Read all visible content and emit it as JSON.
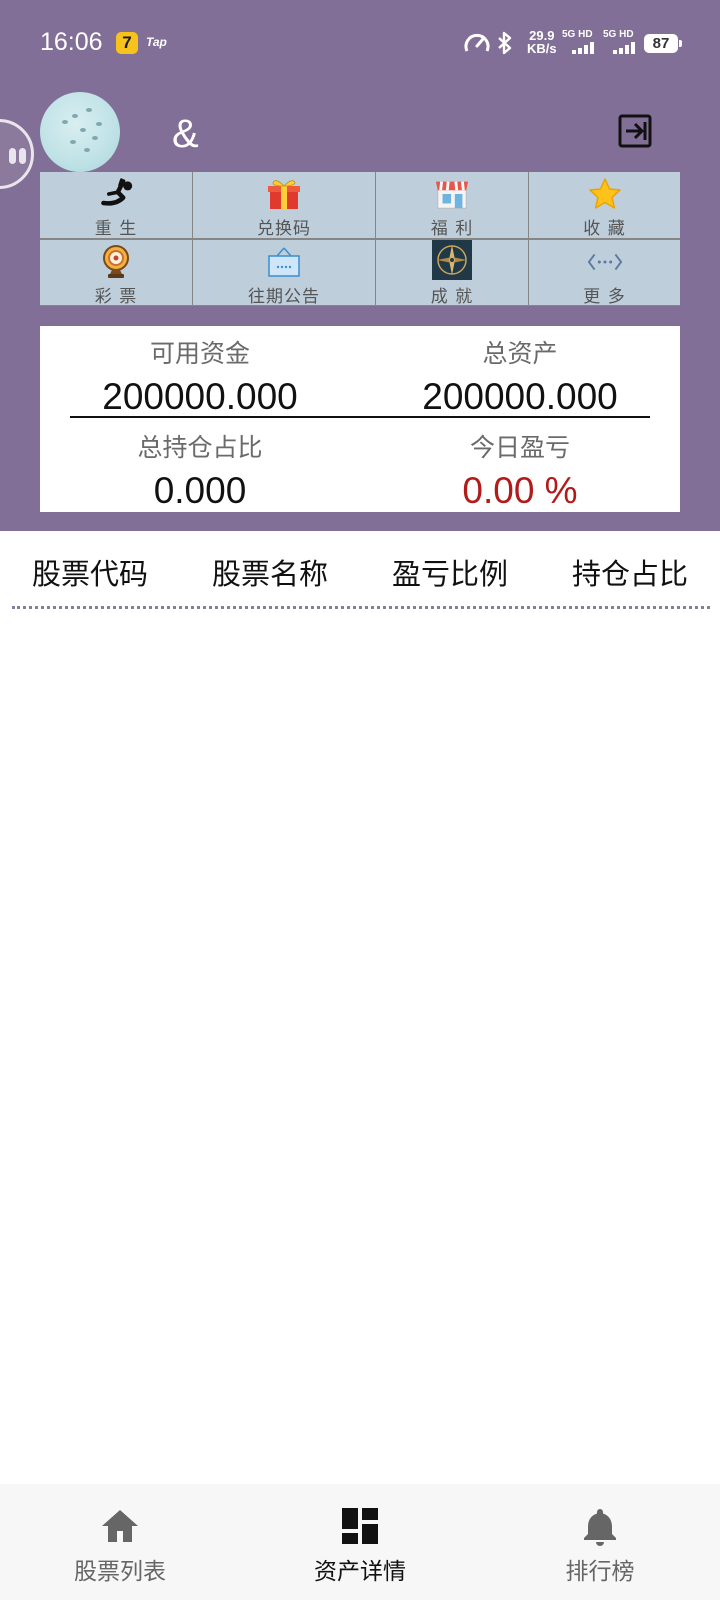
{
  "status_bar": {
    "time": "16:06",
    "app_badge": "7",
    "app_text": "Tap",
    "net_speed_value": "29.9",
    "net_speed_unit": "KB/s",
    "sim1_label": "5G HD",
    "sim2_label": "5G HD",
    "battery_level": "87",
    "icons": [
      "speedometer-icon",
      "bluetooth-icon",
      "signal-icon",
      "battery-icon"
    ]
  },
  "profile": {
    "username": "&",
    "logout_icon": "logout-icon"
  },
  "functions": [
    {
      "label": "重 生",
      "icon": "rebirth-icon"
    },
    {
      "label": "兑换码",
      "icon": "gift-icon"
    },
    {
      "label": "福 利",
      "icon": "shop-icon"
    },
    {
      "label": "收 藏",
      "icon": "star-icon"
    },
    {
      "label": "彩 票",
      "icon": "lottery-wheel-icon"
    },
    {
      "label": "往期公告",
      "icon": "notice-board-icon"
    },
    {
      "label": "成 就",
      "icon": "compass-icon"
    },
    {
      "label": "更 多",
      "icon": "more-icon"
    }
  ],
  "stats": {
    "available_funds_label": "可用资金",
    "available_funds_value": "200000.000",
    "total_assets_label": "总资产",
    "total_assets_value": "200000.000",
    "position_ratio_label": "总持仓占比",
    "position_ratio_value": "0.000",
    "today_pnl_label": "今日盈亏",
    "today_pnl_value": "0.00 %"
  },
  "table": {
    "columns": [
      "股票代码",
      "股票名称",
      "盈亏比例",
      "持仓占比"
    ],
    "rows": []
  },
  "bottom_nav": {
    "items": [
      {
        "label": "股票列表",
        "icon": "home-icon",
        "active": false
      },
      {
        "label": "资产详情",
        "icon": "dashboard-icon",
        "active": true
      },
      {
        "label": "排行榜",
        "icon": "bell-icon",
        "active": false
      }
    ]
  },
  "colors": {
    "header_bg": "#826f97",
    "grid_cell_bg": "#bfcedb",
    "pnl_red": "#b31a1a",
    "nav_bg": "#f7f7f7"
  }
}
